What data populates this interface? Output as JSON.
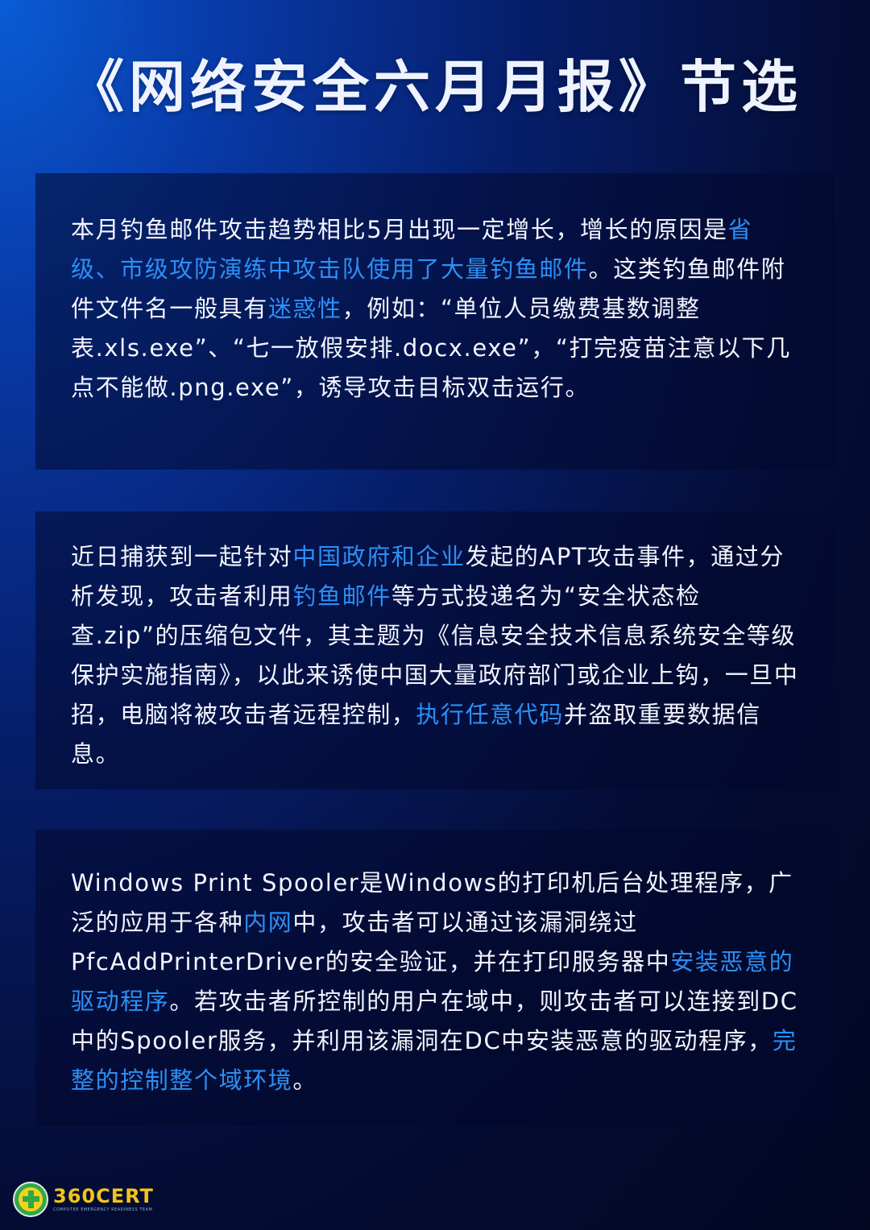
{
  "title": "《网络安全六月月报》节选",
  "card1": {
    "seg1": "本月钓鱼邮件攻击趋势相比5月出现一定增长，增长的原因是",
    "seg2": "省级、市级攻防演练中攻击队使用了大量钓鱼邮件",
    "seg3": "。这类钓鱼邮件附件文件名一般具有",
    "seg4": "迷惑性",
    "seg5": "，例如：“单位人员缴费基数调整表.xls.exe”、“七一放假安排.docx.exe”，“打完疫苗注意以下几点不能做.png.exe”，诱导攻击目标双击运行。"
  },
  "card2": {
    "seg1": "近日捕获到一起针对",
    "seg2": "中国政府和企业",
    "seg3": "发起的APT攻击事件，通过分析发现，攻击者利用",
    "seg4": "钓鱼邮件",
    "seg5": "等方式投递名为“安全状态检查.zip”的压缩包文件，其主题为《信息安全技术信息系统安全等级保护实施指南》，以此来诱使中国大量政府部门或企业上钩，一旦中招，电脑将被攻击者远程控制，",
    "seg6": "执行任意代码",
    "seg7": "并盗取重要数据信息。"
  },
  "card3": {
    "seg1": "Windows Print Spooler是Windows的打印机后台处理程序，广泛的应用于各种",
    "seg2": "内网",
    "seg3": "中，攻击者可以通过该漏洞绕过PfcAddPrinterDriver的安全验证，并在打印服务器中",
    "seg4": "安装恶意的驱动程序",
    "seg5": "。若攻击者所控制的用户在域中，则攻击者可以连接到DC中的Spooler服务，并利用该漏洞在DC中安装恶意的驱动程序，",
    "seg6": "完整的控制整个域环境",
    "seg7": "。"
  },
  "logo": {
    "name": "360CERT",
    "subtitle": "COMPUTER EMERGENCY READINESS TEAM",
    "icon": "360-cross-shield-icon"
  },
  "colors": {
    "highlight": "#2d8ff5",
    "text": "#f2f5ff"
  }
}
